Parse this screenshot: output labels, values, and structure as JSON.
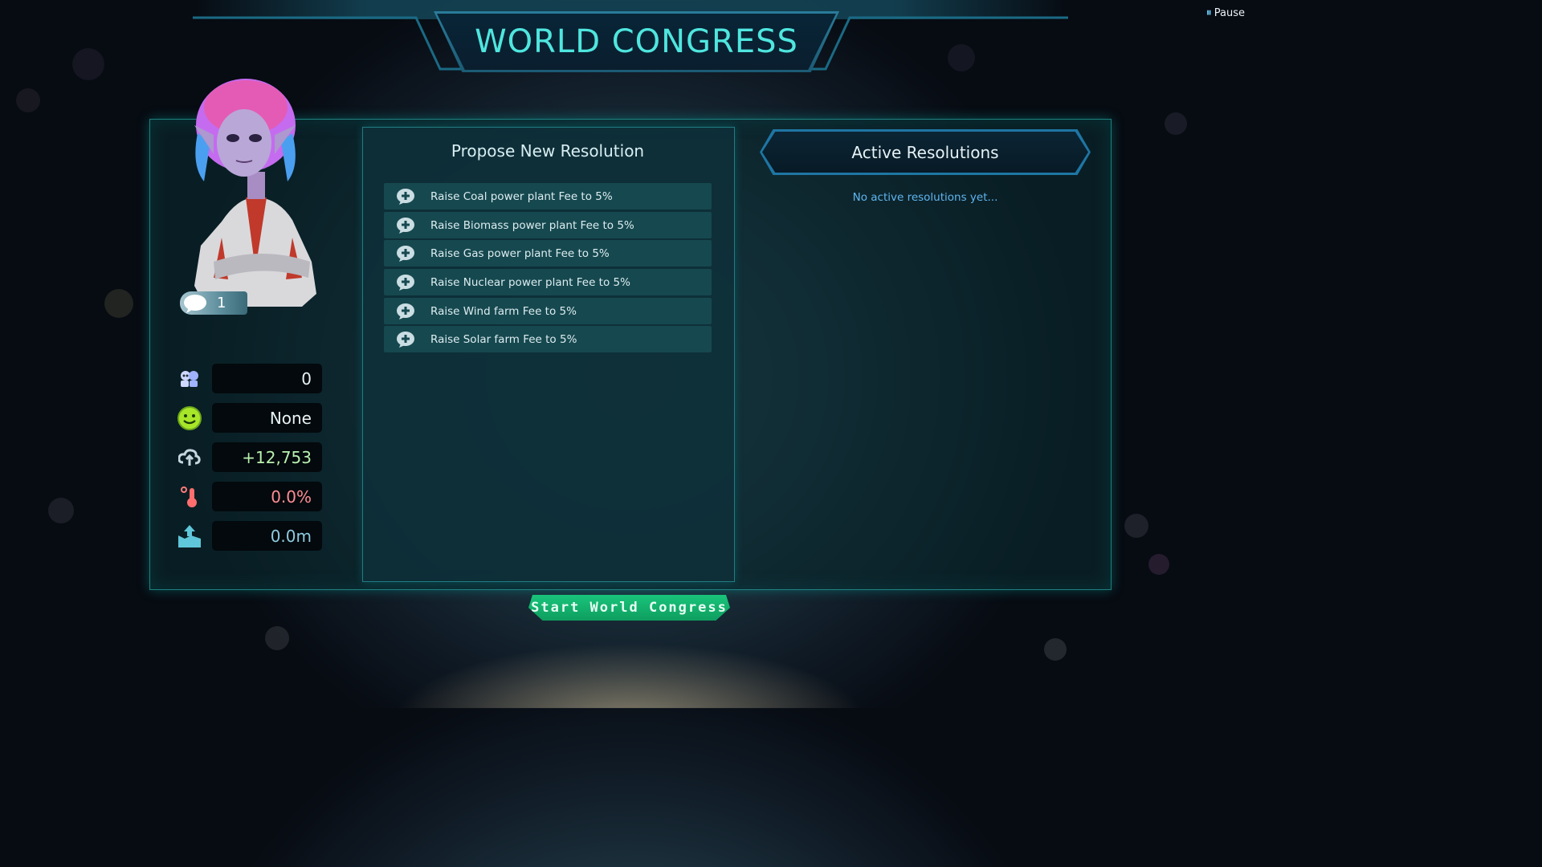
{
  "window": {
    "title": "WORLD CONGRESS",
    "pause_label": "Pause",
    "pause_icon": "pause-icon"
  },
  "advisor": {
    "messages_count": "1",
    "bubble_icon": "speech-bubble-icon"
  },
  "stats": [
    {
      "icon": "population-icon",
      "value": "0",
      "color": "#e8f3f6"
    },
    {
      "icon": "happiness-icon",
      "value": "None",
      "color": "#e8f3f6"
    },
    {
      "icon": "emissions-icon",
      "value": "+12,753",
      "color": "#b9f0b0"
    },
    {
      "icon": "temperature-icon",
      "value": "0.0%",
      "color": "#ff8d95"
    },
    {
      "icon": "sea-level-icon",
      "value": "0.0m",
      "color": "#8fcbe0"
    }
  ],
  "propose": {
    "title": "Propose New Resolution",
    "items": [
      {
        "label": "Raise Coal power plant Fee to 5%",
        "icon": "propose-resolution-icon"
      },
      {
        "label": "Raise Biomass power plant Fee to 5%",
        "icon": "propose-resolution-icon"
      },
      {
        "label": "Raise Gas power plant Fee to 5%",
        "icon": "propose-resolution-icon"
      },
      {
        "label": "Raise Nuclear power plant Fee to 5%",
        "icon": "propose-resolution-icon"
      },
      {
        "label": "Raise Wind farm Fee to 5%",
        "icon": "propose-resolution-icon"
      },
      {
        "label": "Raise Solar farm Fee to 5%",
        "icon": "propose-resolution-icon"
      }
    ]
  },
  "active": {
    "title": "Active Resolutions",
    "empty_text": "No active resolutions yet..."
  },
  "actions": {
    "start_label": "Start World Congress"
  },
  "colors": {
    "accent_cyan": "#4fe6df",
    "button_green": "#19c47b",
    "link_blue": "#5fb6f0"
  }
}
